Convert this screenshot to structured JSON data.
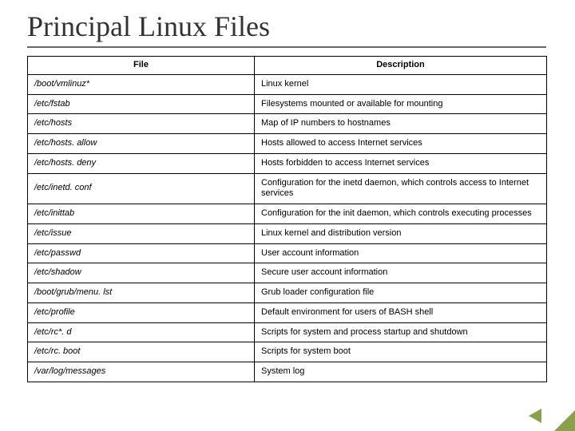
{
  "title": "Principal Linux Files",
  "headers": {
    "file": "File",
    "desc": "Description"
  },
  "rows": [
    {
      "file": "/boot/vmlinuz*",
      "desc": "Linux kernel"
    },
    {
      "file": "/etc/fstab",
      "desc": "Filesystems mounted or available for mounting"
    },
    {
      "file": "/etc/hosts",
      "desc": "Map of IP numbers to hostnames"
    },
    {
      "file": "/etc/hosts. allow",
      "desc": "Hosts allowed to access Internet services"
    },
    {
      "file": "/etc/hosts. deny",
      "desc": "Hosts forbidden to access Internet services"
    },
    {
      "file": "/etc/inetd. conf",
      "desc": "Configuration for the inetd daemon, which controls access to Internet services"
    },
    {
      "file": "/etc/inittab",
      "desc": "Configuration for the init daemon, which controls executing processes"
    },
    {
      "file": "/etc/issue",
      "desc": "Linux kernel and distribution version"
    },
    {
      "file": "/etc/passwd",
      "desc": "User account information"
    },
    {
      "file": "/etc/shadow",
      "desc": "Secure user account information"
    },
    {
      "file": "/boot/grub/menu. lst",
      "desc": "Grub loader configuration file"
    },
    {
      "file": "/etc/profile",
      "desc": "Default environment for users of BASH shell"
    },
    {
      "file": "/etc/rc*. d",
      "desc": "Scripts for system and process startup and shutdown"
    },
    {
      "file": "/etc/rc. boot",
      "desc": "Scripts for system boot"
    },
    {
      "file": "/var/log/messages",
      "desc": "System log"
    }
  ]
}
